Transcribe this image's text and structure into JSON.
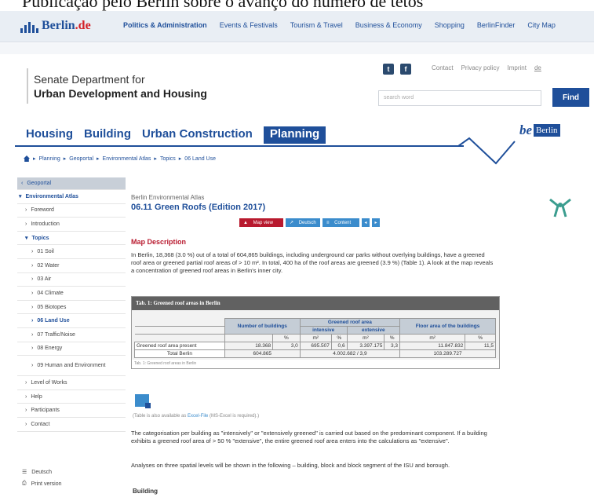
{
  "caption": "Publicação pelo Berlin sobre o avanço do número de tetos",
  "topbar": {
    "logo": {
      "text_a": "Berlin",
      "text_b": ".de"
    },
    "nav": [
      "Politics & Administration",
      "Events & Festivals",
      "Tourism & Travel",
      "Business & Economy",
      "Shopping",
      "BerlinFinder",
      "City Map"
    ]
  },
  "header": {
    "dept_line1": "Senate Department for",
    "dept_line2": "Urban Development and Housing",
    "social": [
      "t",
      "f"
    ],
    "links": [
      "Contact",
      "Privacy policy",
      "Imprint",
      "de"
    ],
    "search_placeholder": "search word",
    "find_label": "Find"
  },
  "mainnav": {
    "tabs": [
      "Housing",
      "Building",
      "Urban Construction",
      "Planning"
    ],
    "active": "Planning",
    "brand_be": "be",
    "brand_box": "Berlin"
  },
  "breadcrumb": [
    "Planning",
    "Geoportal",
    "Environmental Atlas",
    "Topics",
    "06 Land Use"
  ],
  "sidebar": {
    "items": [
      {
        "label": "Geoportal",
        "kind": "geo"
      },
      {
        "label": "Environmental Atlas",
        "kind": "env"
      },
      {
        "label": "Foreword",
        "kind": "lvl1"
      },
      {
        "label": "Introduction",
        "kind": "lvl1"
      },
      {
        "label": "Topics",
        "kind": "topics"
      },
      {
        "label": "01 Soil",
        "kind": "lvl2"
      },
      {
        "label": "02 Water",
        "kind": "lvl2"
      },
      {
        "label": "03 Air",
        "kind": "lvl2"
      },
      {
        "label": "04 Climate",
        "kind": "lvl2"
      },
      {
        "label": "05 Biotopes",
        "kind": "lvl2"
      },
      {
        "label": "06 Land Use",
        "kind": "lvl2 current"
      },
      {
        "label": "07 Traffic/Noise",
        "kind": "lvl2"
      },
      {
        "label": "08 Energy",
        "kind": "lvl2"
      },
      {
        "label": "09 Human and Environment",
        "kind": "lvl2 tall"
      },
      {
        "label": "Level of Works",
        "kind": "lvl1"
      },
      {
        "label": "Help",
        "kind": "lvl1"
      },
      {
        "label": "Participants",
        "kind": "lvl1"
      },
      {
        "label": "Contact",
        "kind": "lvl1"
      }
    ],
    "deutsch": "Deutsch",
    "print": "Print version"
  },
  "content": {
    "eyebrow": "Berlin Environmental Atlas",
    "title": "06.11 Green Roofs (Edition 2017)",
    "btn_map": "Map view",
    "btn_de": "Deutsch",
    "btn_content": "Content",
    "map_desc_heading": "Map Description",
    "para1": "In Berlin, 18,368 (3.0 %) out of a total of 604,865 buildings, including underground car parks without overlying buildings, have a greened roof area or greened partial roof areas of > 10 m². In total, 400 ha of the roof areas are greened (3.9 %) (Table 1). A look at the map reveals a concentration of greened roof areas in Berlin's inner city.",
    "table": {
      "caption": "Tab. 1: Greened roof areas in Berlin",
      "h_number": "Number of buildings",
      "h_greened": "Greened roof area",
      "h_intensive": "intensive",
      "h_extensive": "extensive",
      "h_floor": "Floor area of the buildings",
      "unit_pct": "%",
      "unit_m2": "m²",
      "row1": {
        "label": "Greened roof area present",
        "n": "18.368",
        "np": "3,0",
        "i": "695.507",
        "ip": "0,6",
        "e": "3.397.175",
        "ep": "3,3",
        "f": "11.847.832",
        "fp": "11,5"
      },
      "row2": {
        "label": "Total Berlin",
        "n": "604.865",
        "g": "4.002.682  /  3,9",
        "f": "103.289.727"
      },
      "note": "Tab. 1: Greened roof areas in Berlin"
    },
    "excel_note_pre": "(Table is also available as ",
    "excel_note_link": "Excel-File",
    "excel_note_post": " (MS-Excel is required).)",
    "para2": "The categorisation per building as \"intensively\" or \"extensively greened\" is carried out based on the predominant component. If a building exhibits a greened roof area of > 50 % \"extensive\", the entire greened roof area enters into the calculations as \"extensive\".",
    "para3": "Analyses on three spatial levels will be shown in the following – building, block and block segment of the ISU and borough.",
    "building_heading": "Building"
  }
}
